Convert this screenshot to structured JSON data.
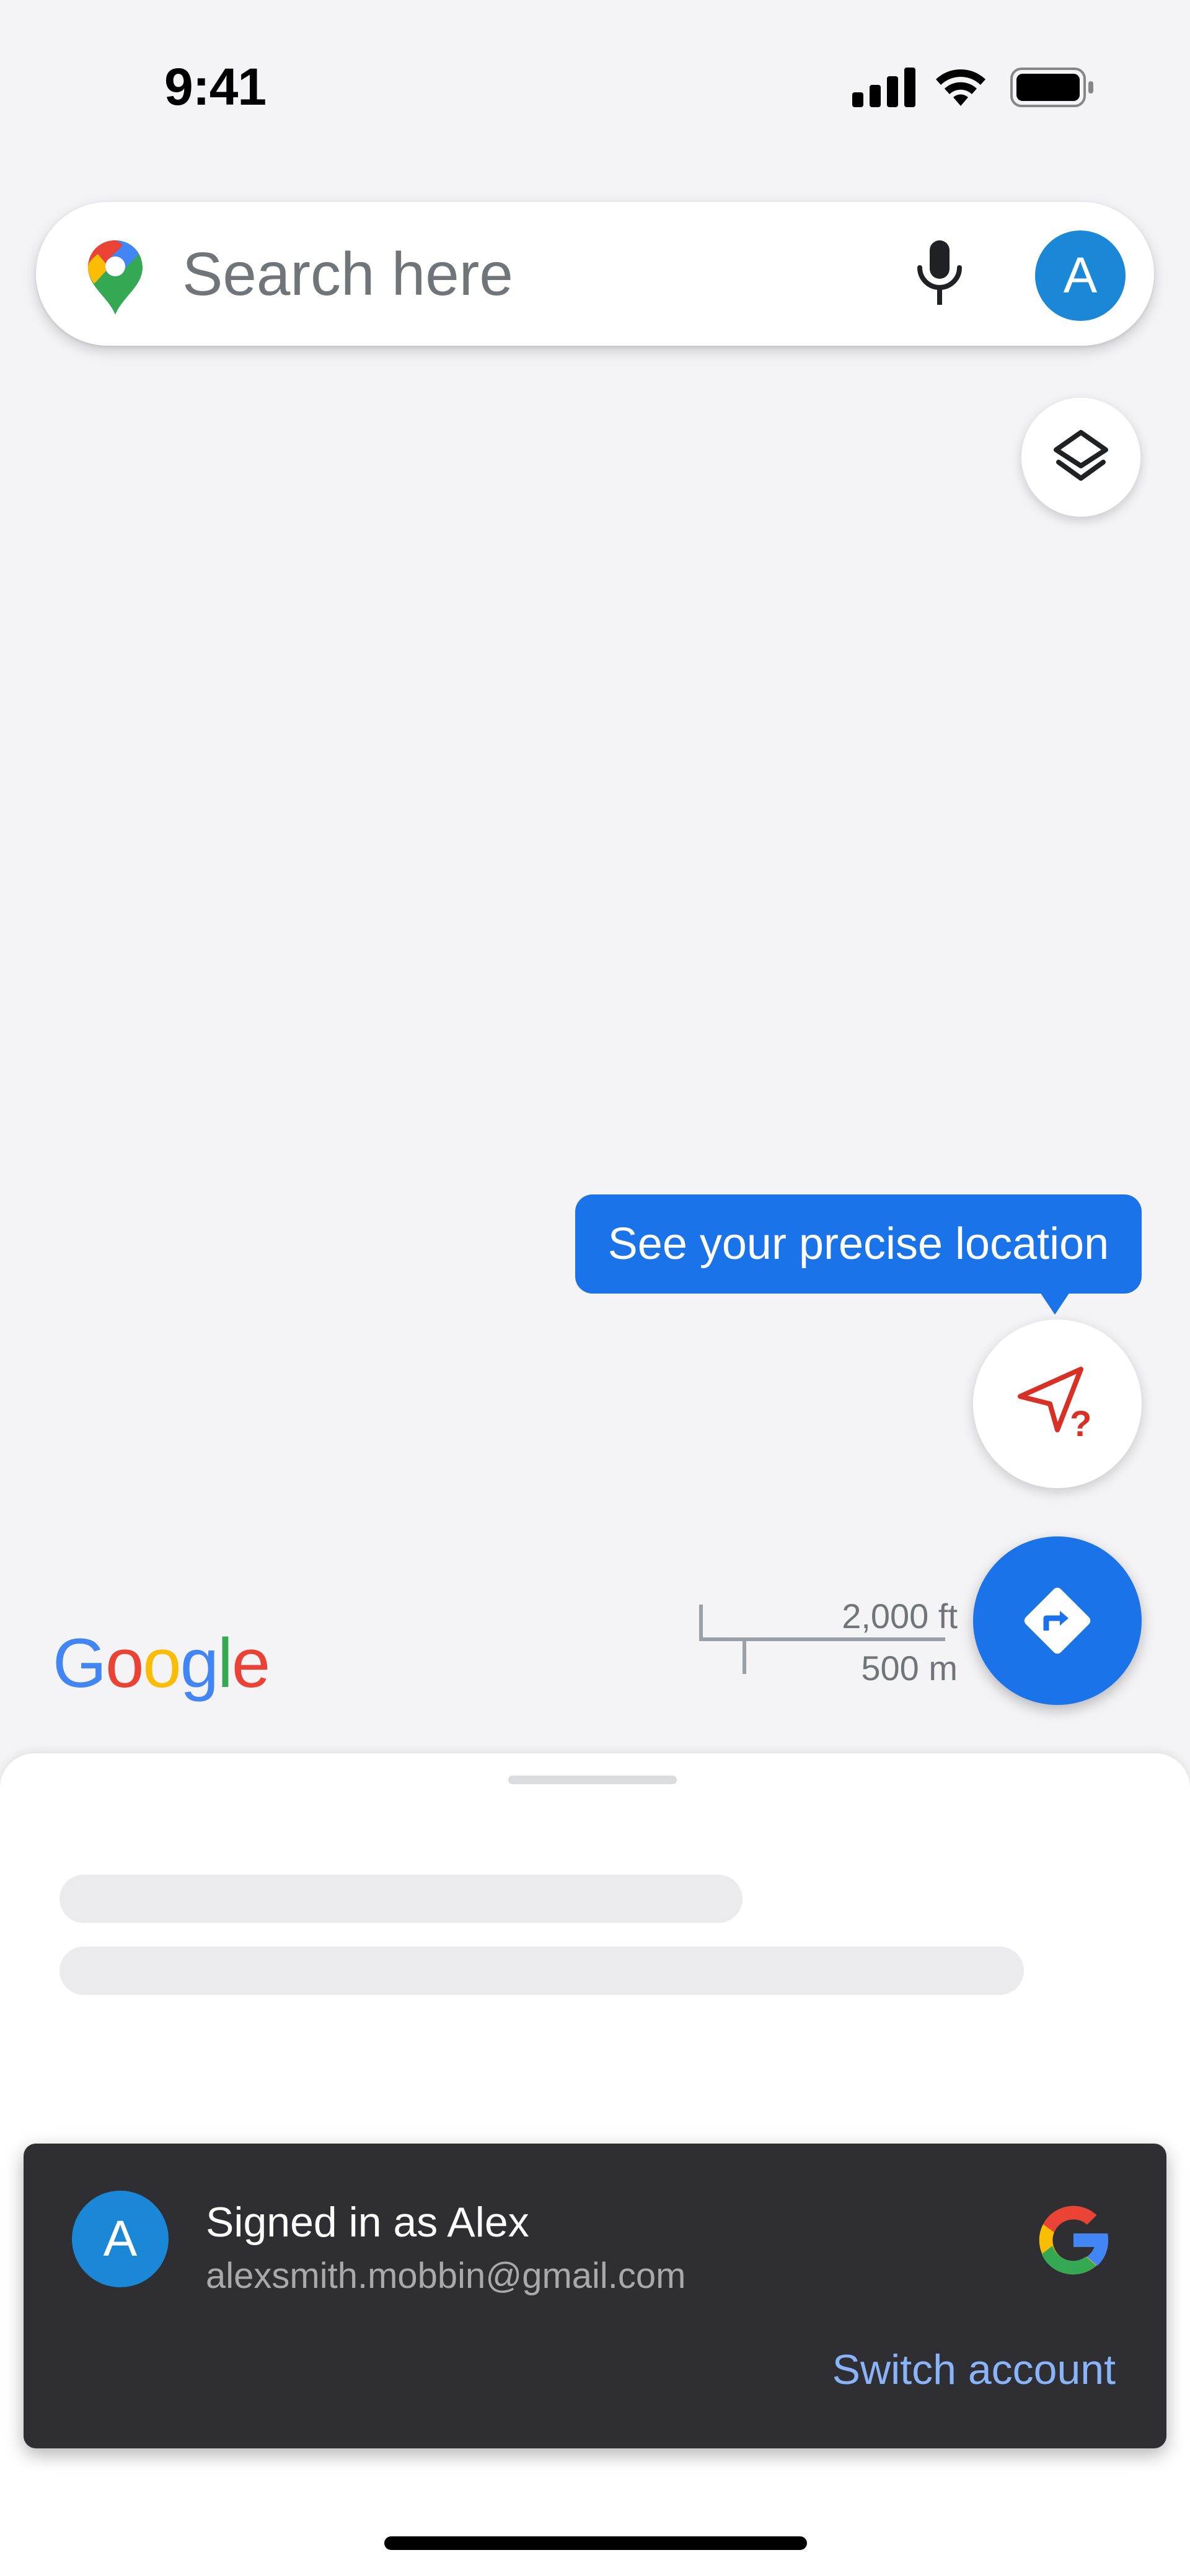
{
  "status_bar": {
    "time": "9:41",
    "icons": [
      "signal-icon",
      "wifi-icon",
      "battery-icon"
    ]
  },
  "search": {
    "placeholder": "Search here",
    "avatar_letter": "A",
    "icons": [
      "maps-pin-icon",
      "mic-icon"
    ]
  },
  "map": {
    "tooltip": "See your precise location",
    "logo": "Google",
    "scale_imperial": "2,000 ft",
    "scale_metric": "500 m",
    "icons": [
      "layers-icon",
      "location-unknown-icon",
      "directions-icon"
    ]
  },
  "snackbar": {
    "avatar_letter": "A",
    "title": "Signed in as Alex",
    "email": "alexsmith.mobbin@gmail.com",
    "action": "Switch account",
    "icon": "google-g-icon"
  },
  "colors": {
    "accent_blue": "#1a73e8",
    "avatar_blue": "#1a88d6",
    "snackbar_bg": "#2e2e33",
    "snackbar_action": "#8ab4f8",
    "location_red": "#d93025"
  }
}
